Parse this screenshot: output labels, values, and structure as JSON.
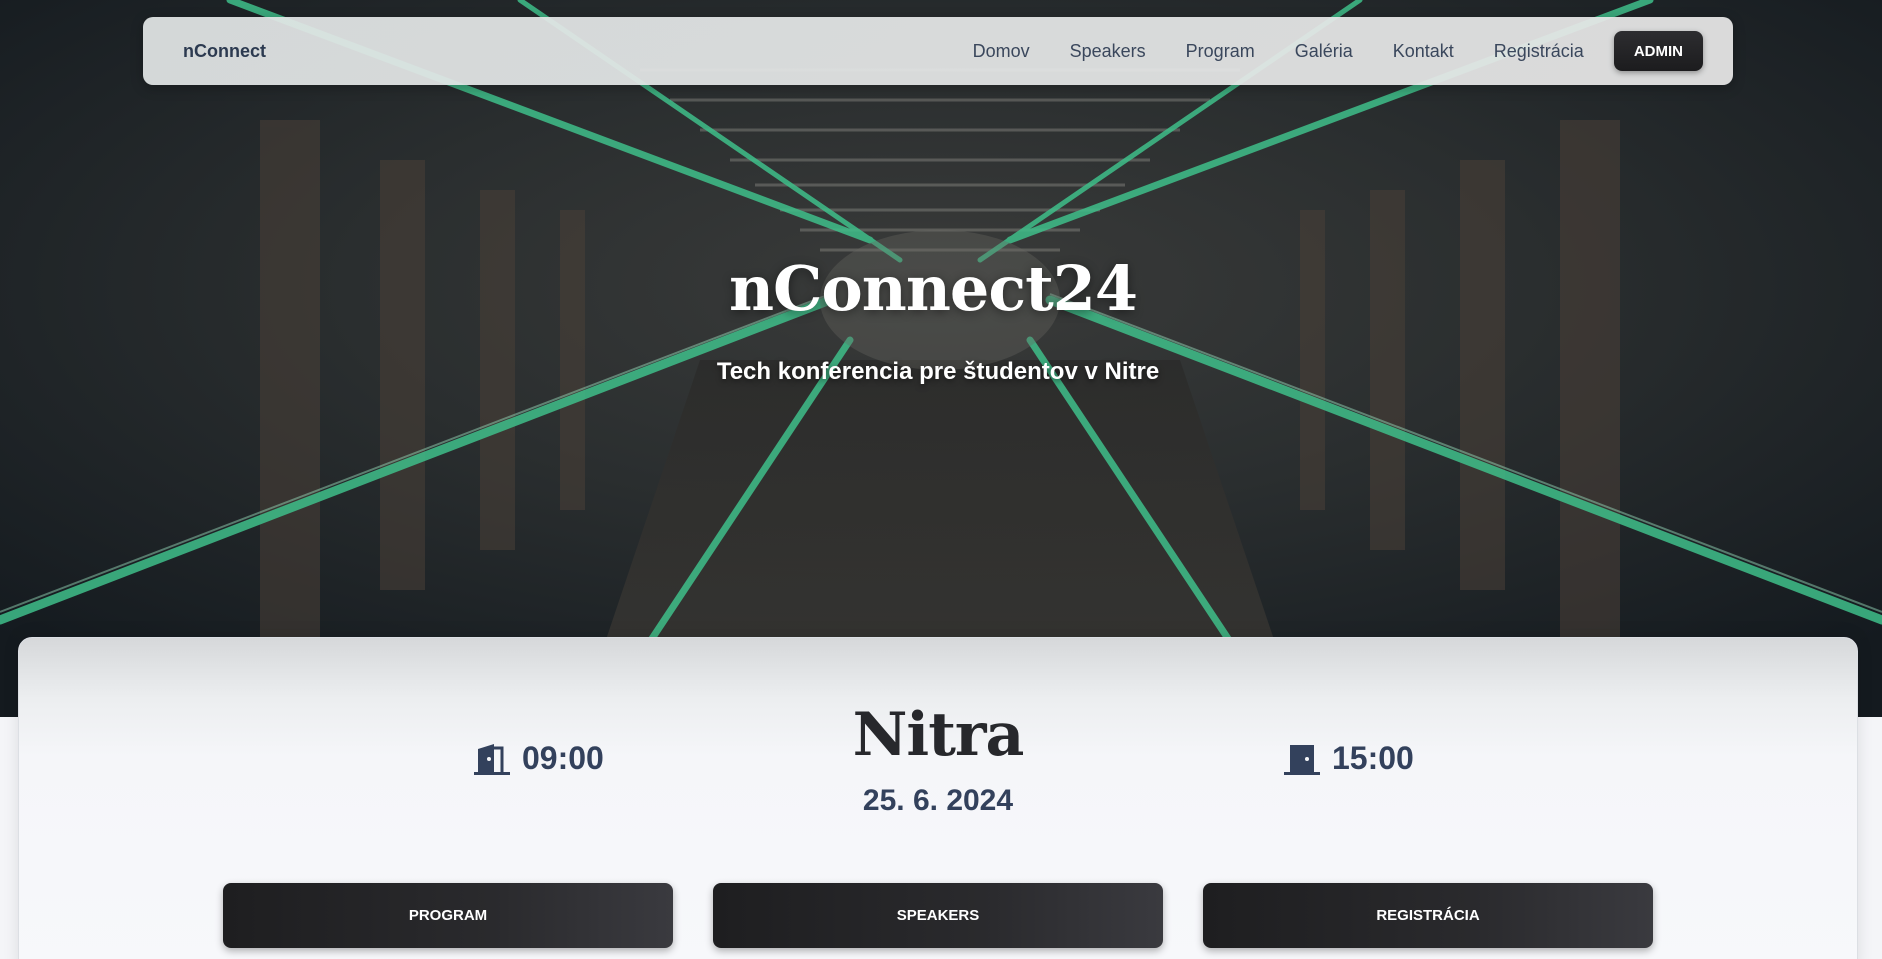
{
  "navbar": {
    "brand": "nConnect",
    "links": [
      "Domov",
      "Speakers",
      "Program",
      "Galéria",
      "Kontakt",
      "Registrácia"
    ],
    "admin_label": "ADMIN"
  },
  "hero": {
    "title": "nConnect24",
    "subtitle": "Tech konferencia pre študentov v Nitre"
  },
  "event": {
    "start_time": "09:00",
    "end_time": "15:00",
    "city": "Nitra",
    "date": "25. 6. 2024",
    "start_icon": "door-open-icon",
    "end_icon": "door-closed-icon"
  },
  "actions": {
    "program": "PROGRAM",
    "speakers": "SPEAKERS",
    "registracia": "REGISTRÁCIA"
  },
  "colors": {
    "accent_green": "#3fbf8a",
    "dark_button": "#1e1e20",
    "text_navy": "#33415c"
  }
}
